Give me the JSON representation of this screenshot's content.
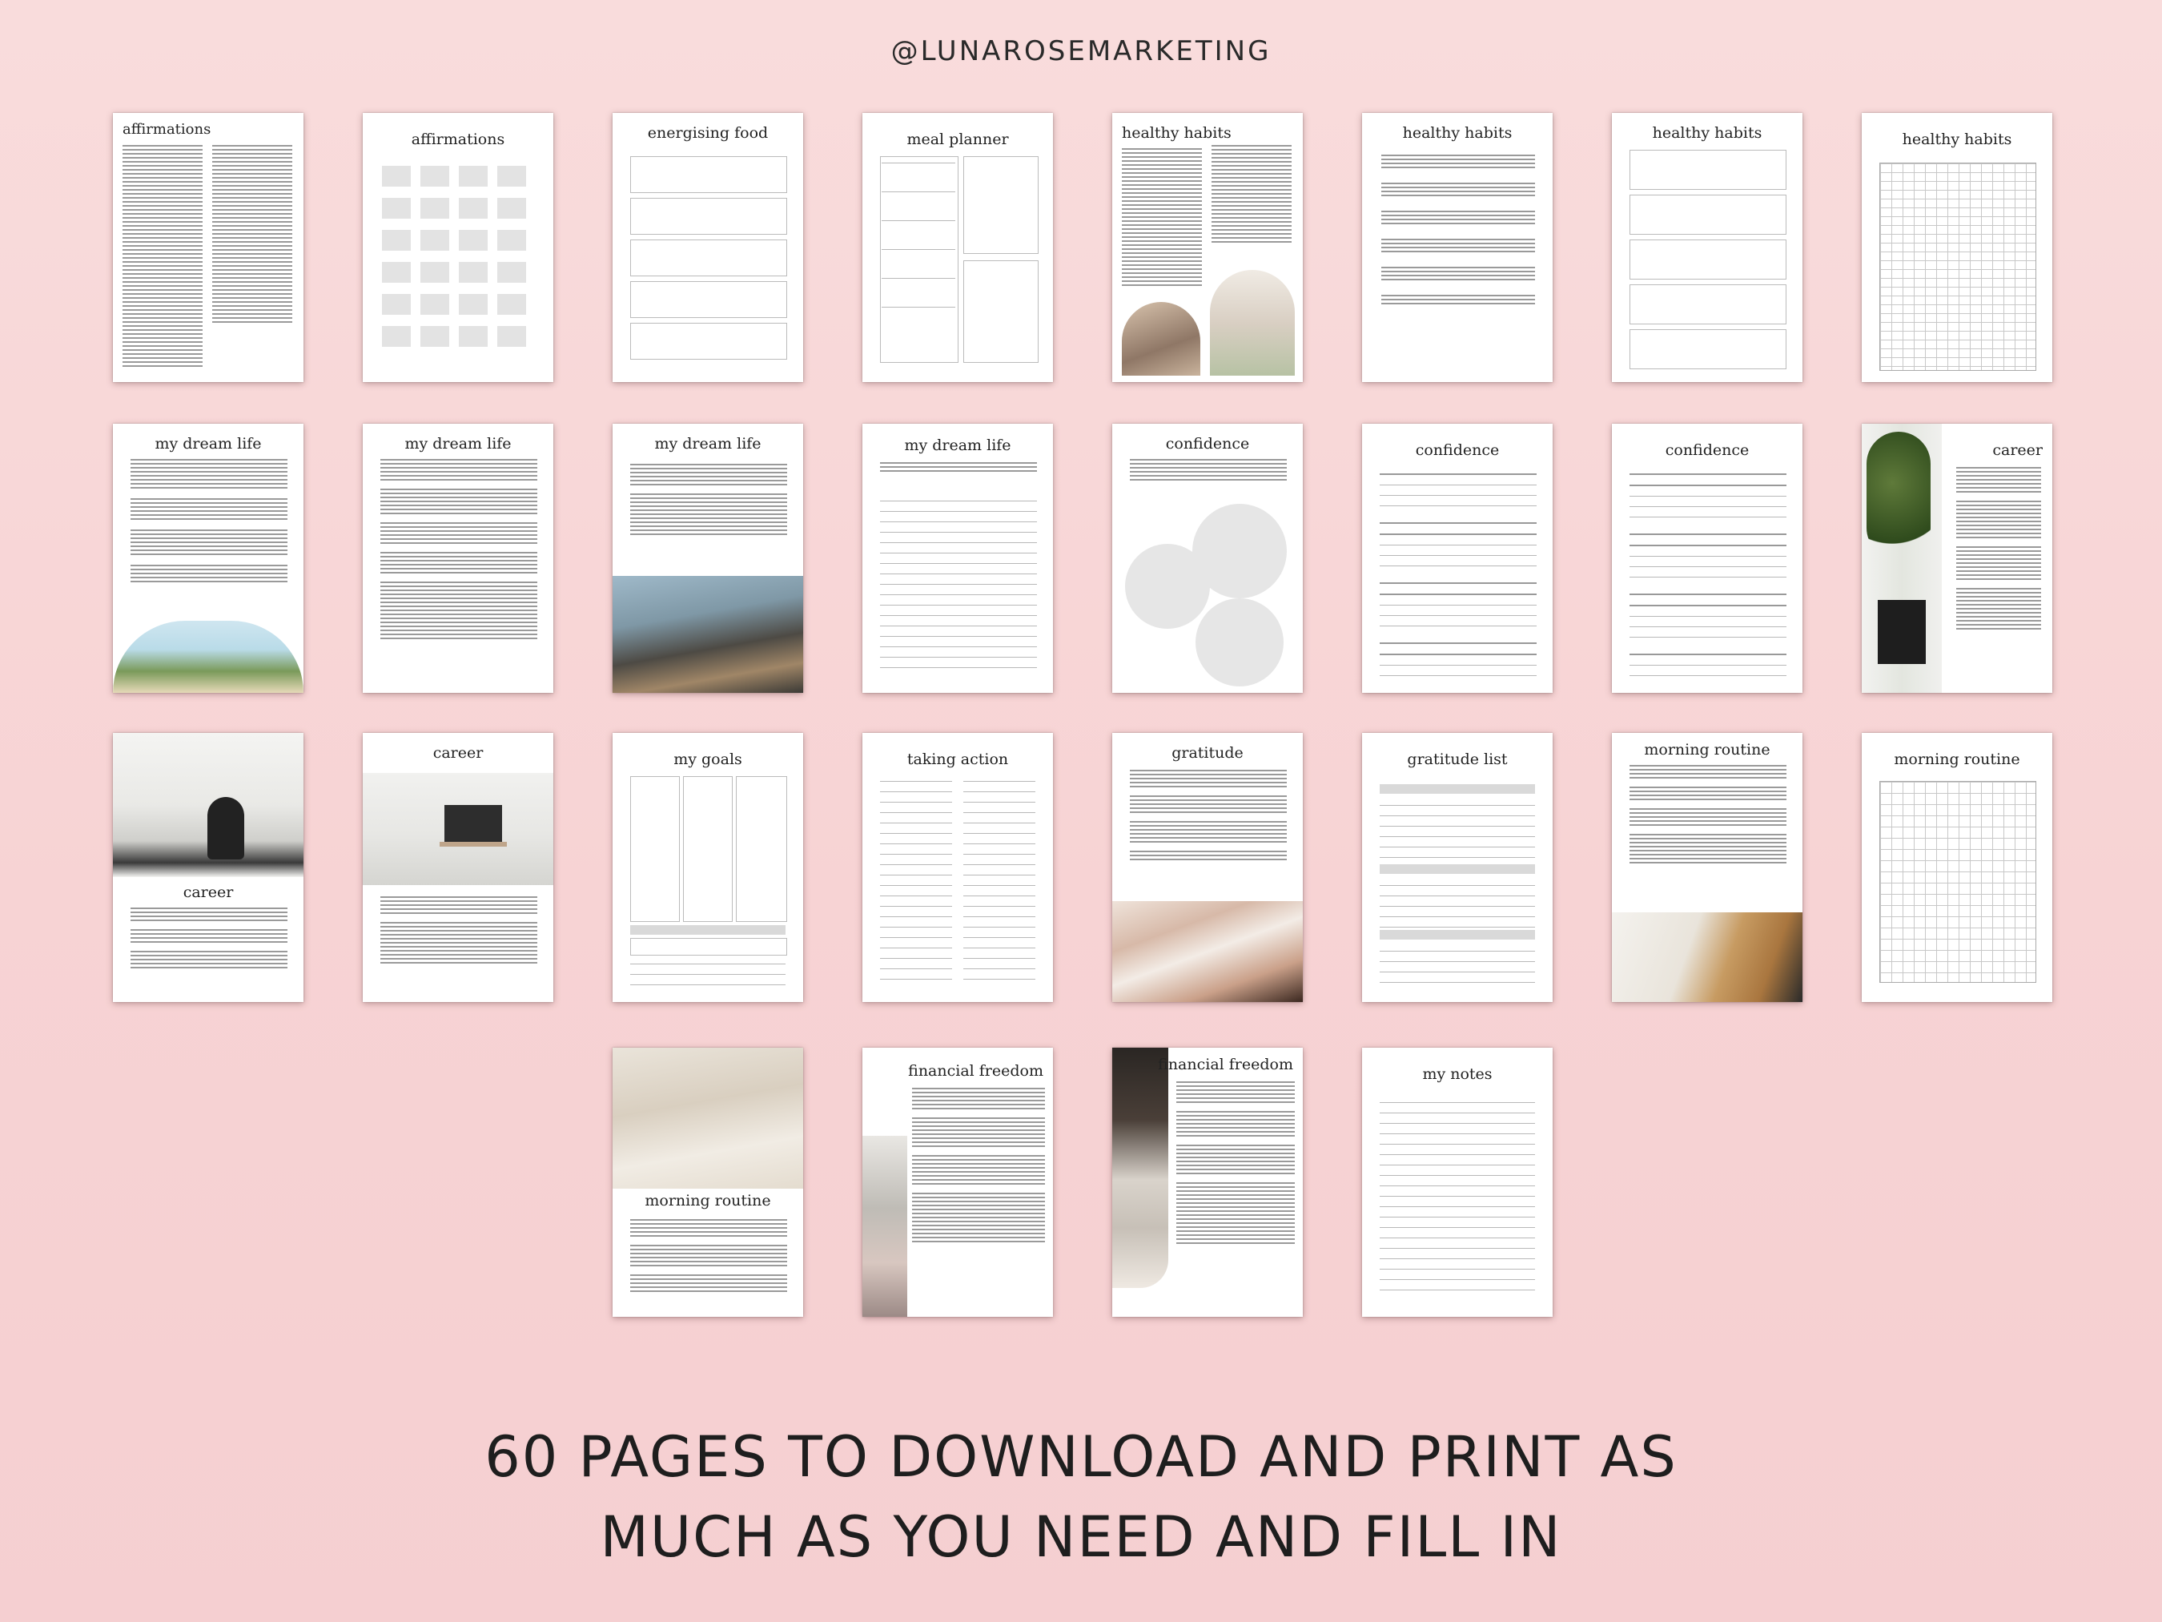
{
  "handle": "@LUNAROSEMARKETING",
  "pages": {
    "affirmations1": "affirmations",
    "affirmations2": "affirmations",
    "energising_food": "energising food",
    "meal_planner": "meal planner",
    "healthy_habits1": "healthy habits",
    "healthy_habits2": "healthy habits",
    "healthy_habits3": "healthy habits",
    "healthy_habits4": "healthy habits",
    "dream_life1": "my dream life",
    "dream_life2": "my dream life",
    "dream_life3": "my dream life",
    "dream_life4": "my dream life",
    "confidence1": "confidence",
    "confidence2": "confidence",
    "confidence3": "confidence",
    "career1": "career",
    "career2": "career",
    "career3": "career",
    "my_goals": "my goals",
    "taking_action": "taking action",
    "gratitude": "gratitude",
    "gratitude_list": "gratitude list",
    "morning_routine1": "morning routine",
    "morning_routine2": "morning routine",
    "morning_routine3": "morning routine",
    "financial_freedom1": "financial freedom",
    "financial_freedom2": "financial freedom",
    "my_notes": "my notes"
  },
  "footer": {
    "line1": "60 PAGES TO DOWNLOAD AND PRINT AS",
    "line2": "MUCH AS YOU NEED AND FILL IN"
  },
  "colors": {
    "background": "#f7d5d6",
    "page": "#ffffff",
    "text": "#1e1e1e"
  }
}
